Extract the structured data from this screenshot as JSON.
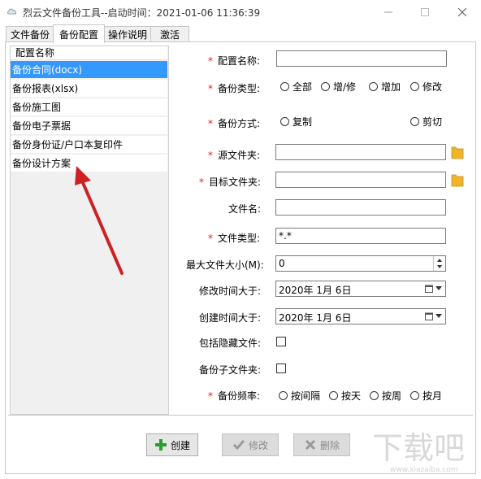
{
  "window": {
    "title": "烈云文件备份工具--启动时间：2021-01-06 11:36:39",
    "controls": [
      "minimize",
      "maximize",
      "close"
    ]
  },
  "tabs": [
    {
      "label": "文件备份",
      "active": false
    },
    {
      "label": "备份配置",
      "active": true
    },
    {
      "label": "操作说明",
      "active": false
    },
    {
      "label": "激活",
      "active": false
    }
  ],
  "config_list": {
    "header": "配置名称",
    "items": [
      {
        "label": "备份合同(docx)",
        "selected": true
      },
      {
        "label": "备份报表(xlsx)",
        "selected": false
      },
      {
        "label": "备份施工图",
        "selected": false
      },
      {
        "label": "备份电子票据",
        "selected": false
      },
      {
        "label": "备份身份证/户口本复印件",
        "selected": false
      },
      {
        "label": "备份设计方案",
        "selected": false
      }
    ]
  },
  "form": {
    "required_mark": "*",
    "config_name": {
      "label": "配置名称:",
      "value": ""
    },
    "backup_type": {
      "label": "备份类型:",
      "options": [
        "全部",
        "增/修",
        "增加",
        "修改"
      ],
      "selected": null
    },
    "backup_mode": {
      "label": "备份方式:",
      "options": [
        "复制",
        "剪切"
      ],
      "selected": null
    },
    "source_folder": {
      "label": "源文件夹:",
      "value": ""
    },
    "target_folder": {
      "label": "目标文件夹:",
      "value": ""
    },
    "file_name": {
      "label": "文件名:",
      "value": ""
    },
    "file_type": {
      "label": "文件类型:",
      "value": "*.*"
    },
    "max_file_size": {
      "label": "最大文件大小(M):",
      "value": "0"
    },
    "modified_after": {
      "label": "修改时间大于:",
      "value": "2020年  1月  6日"
    },
    "created_after": {
      "label": "创建时间大于:",
      "value": "2020年  1月  6日"
    },
    "include_hidden": {
      "label": "包括隐藏文件:",
      "checked": false
    },
    "backup_subfolders": {
      "label": "备份子文件夹:",
      "checked": false
    },
    "backup_frequency": {
      "label": "备份频率:",
      "options": [
        "按间隔",
        "按天",
        "按周",
        "按月"
      ],
      "selected": null
    }
  },
  "buttons": {
    "create": "创建",
    "modify": "修改",
    "delete": "删除"
  },
  "icons": {
    "app": "cloud-app-icon",
    "folder": "folder-icon",
    "create": "plus-icon",
    "modify": "checkmark-icon",
    "delete": "x-icon",
    "calendar": "calendar-icon"
  },
  "colors": {
    "selection": "#3399ff",
    "required": "#e02020",
    "create_plus": "#2a9d2a",
    "folder": "#f0b429",
    "annotation_arrow": "#cc2222"
  },
  "watermark": {
    "text": "下载吧",
    "url_text": "www.xiazaiba.com"
  }
}
